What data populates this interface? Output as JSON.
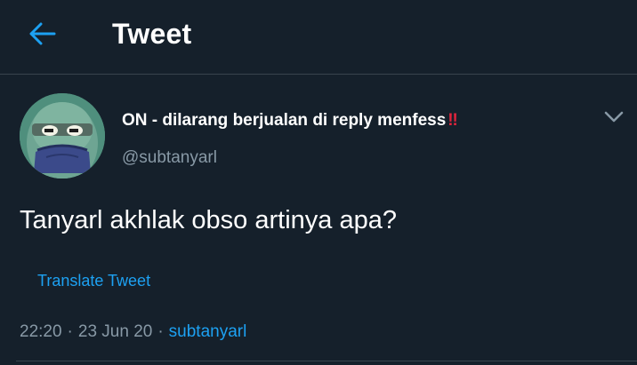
{
  "colors": {
    "background": "#15202b",
    "accent": "#1da1f2",
    "secondary_text": "#8899a6",
    "divider": "#38444d",
    "alert_red": "#e0243c"
  },
  "header": {
    "back_icon": "arrow-left-icon",
    "title": "Tweet"
  },
  "tweet": {
    "author": {
      "display_name": "ON - dilarang berjualan di reply menfess",
      "display_name_emoji": "‼",
      "handle": "@subtanyarl",
      "avatar_icon": "cartoon-fish-avatar"
    },
    "more_icon": "chevron-down-icon",
    "text": "Tanyarl akhlak obso artinya apa?",
    "translate_label": "Translate Tweet",
    "time": "22:20",
    "date": "23 Jun 20",
    "separator": "·",
    "source": "subtanyarl"
  }
}
